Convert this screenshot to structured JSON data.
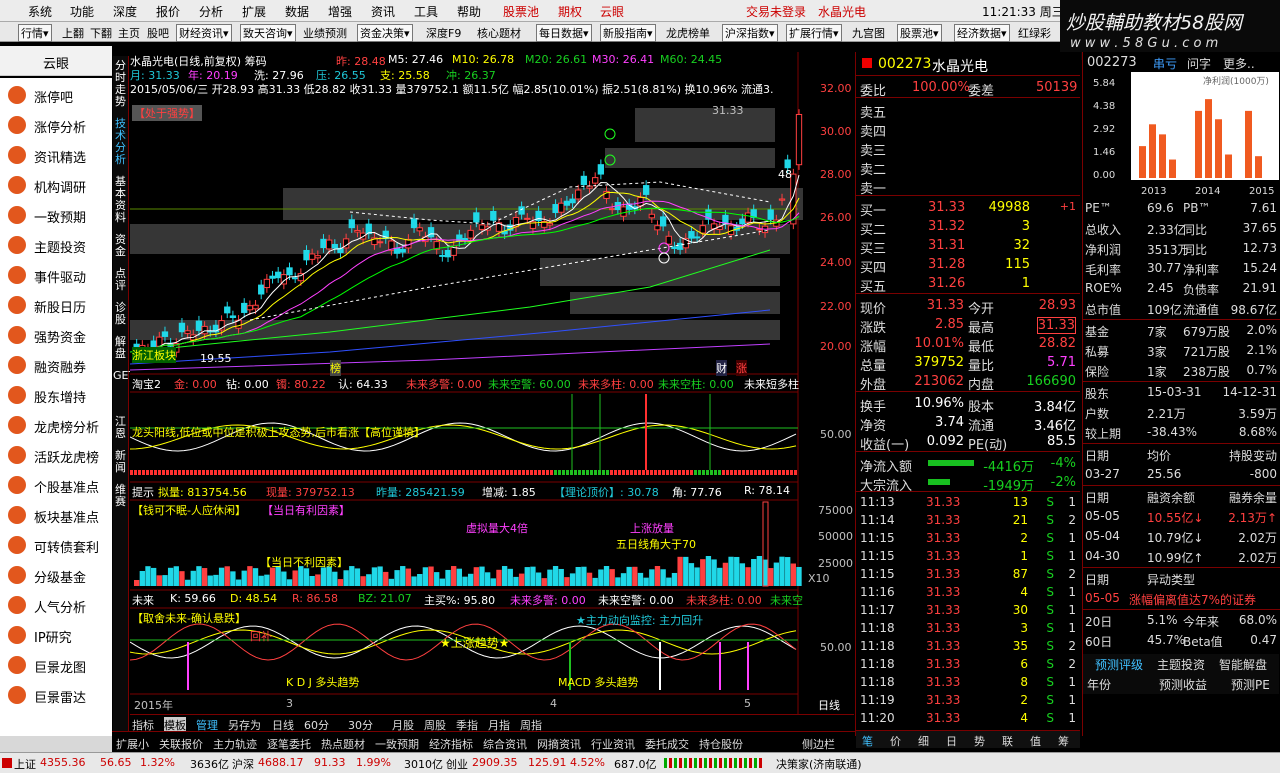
{
  "menu": {
    "items": [
      "系统",
      "功能",
      "深度",
      "报价",
      "分析",
      "扩展",
      "数据",
      "增强",
      "资讯",
      "工具",
      "帮助"
    ],
    "red_items": [
      "股票池",
      "期权",
      "云眼"
    ],
    "login": "交易未登录",
    "stock": "水晶光电",
    "clock": "11:21:33 周三"
  },
  "toolbar": {
    "items": [
      "行情▾",
      "上翻",
      "下翻",
      "主页",
      "股吧",
      "财经资讯▾",
      "致天咨询▾",
      "业绩预测",
      "资金决策▾",
      "深度F9",
      "核心题材",
      "每日数据▾",
      "新股指南▾",
      "龙虎榜单",
      "沪深指数▾",
      "扩展行情▾",
      "九宫图",
      "股票池▾",
      "经济数据▾",
      "红绿彩"
    ]
  },
  "banner": {
    "text": "炒股輔助教材58股网",
    "url": "w w w . 5 8 G u . c o m"
  },
  "sidebar": {
    "title": "云眼",
    "items": [
      "涨停吧",
      "涨停分析",
      "资讯精选",
      "机构调研",
      "一致预期",
      "主题投资",
      "事件驱动",
      "新股日历",
      "强势资金",
      "融资融券",
      "股东增持",
      "龙虎榜分析",
      "活跃龙虎榜",
      "个股基准点",
      "板块基准点",
      "可转债套利",
      "分级基金",
      "人气分析",
      "IP研究",
      "巨景龙图",
      "巨景雷达"
    ]
  },
  "vtabs": [
    "分时走势",
    "技术分析",
    "基本资料",
    "资金",
    "点评",
    "诊股",
    "解盘",
    "GET",
    "江恩",
    "新闻",
    "维赛"
  ],
  "kline": {
    "title": "水晶光电(日线,前复权)  筹码",
    "ma_line": {
      "zuo": "昨: 28.48",
      "m5": "M5: 27.46",
      "m10": "M10: 26.78",
      "m20": "M20: 26.61",
      "m30": "M30: 26.41",
      "m60": "M60: 24.45"
    },
    "line2": {
      "a": "月: 31.33",
      "b": "年: 20.19",
      "c": "洗: 27.96",
      "d": "压: 26.55",
      "e": "支: 25.58",
      "f": "冲: 26.37"
    },
    "bar_info": "2015/05/06/三 开28.93 高31.33 低28.82 收31.33 量379752.1 额11.5亿 幅2.85(10.01%) 振2.51(8.81%) 换10.96% 流通3.",
    "strong": "【处于强势】",
    "hi_label": "31.33",
    "lo_label": "19.55",
    "side_label": "48",
    "tag_bang": "榜",
    "tag_cai": "财",
    "tag_zhang": "涨",
    "tag_limit": "浙江板块",
    "yaxis": [
      "32.00",
      "30.00",
      "28.00",
      "26.00",
      "24.00",
      "22.00",
      "20.00"
    ]
  },
  "ind1": {
    "row": {
      "name": "淘宝2",
      "a": "金: 0.00",
      "b": "钻: 0.00",
      "c": "镯: 80.22",
      "d": "认: 64.33",
      "e": "未来多警: 0.00",
      "f": "未来空警: 60.00",
      "g": "未来多柱: 0.00",
      "h": "未来空柱: 0.00",
      "i": "未来短多柱"
    },
    "msg": "龙头阳线,低位或中位是积极上攻态势,后市看涨【高位谨慎】",
    "yaxis": "50.00"
  },
  "ind2": {
    "row": {
      "a": "提示",
      "b": "拟量: 813754.56",
      "c": "现量: 379752.13",
      "d": "昨量: 285421.59",
      "e": "增减: 1.85",
      "f": "【理论顶价】: 30.78",
      "g": "角: 77.76",
      "h": "R: 78.14"
    },
    "sub": "【钱可不眠-人应休闲】",
    "sub2": "【当日有利因素】",
    "m1": "虚拟量大4倍",
    "m2": "上涨放量",
    "m3": "五日线角大于70",
    "m4": "【当日不利因素】",
    "yaxis": [
      "75000",
      "50000",
      "25000"
    ],
    "x10": "X10"
  },
  "ind3": {
    "row": {
      "a": "未来",
      "b": "K: 59.66",
      "c": "D: 48.54",
      "d": "R: 86.58",
      "e": "BZ: 21.07",
      "f": "主买%: 95.80",
      "g": "未来多警: 0.00",
      "h": "未来空警: 0.00",
      "i": "未来多柱: 0.00",
      "j": "未来空"
    },
    "sub": "【取舍未来-确认悬跌】",
    "note": "★主力动向监控: 主力回升",
    "mid": "★上涨趋势★",
    "k1": "K D J 多头趋势",
    "k2": "MACD 多头趋势",
    "yaxis": "50.00",
    "tag": "回补"
  },
  "xaxis": {
    "a": "2015年",
    "b": "3",
    "c": "4",
    "d": "5",
    "e": "日线"
  },
  "btabs": [
    "指标",
    "模板",
    "管理",
    "另存为",
    "日线",
    "60分",
    "30分",
    "月股",
    "周股",
    "季指",
    "月指",
    "周指"
  ],
  "ftabs": [
    "扩展小",
    "关联报价",
    "主力轨迹",
    "逐笔委托",
    "热点题材",
    "一致预期",
    "经济指标",
    "综合资讯",
    "网摘资讯",
    "行业资讯",
    "委托成交",
    "持仓股份",
    "侧边栏"
  ],
  "quote": {
    "code": "002273",
    "name": "水晶光电",
    "wb_label": "委比",
    "wb": "100.00%",
    "wc_label": "委差",
    "wc": "50139",
    "sells": [
      "卖五",
      "卖四",
      "卖三",
      "卖二",
      "卖一"
    ],
    "buys": [
      {
        "l": "买一",
        "p": "31.33",
        "v": "49988",
        "c": "+1"
      },
      {
        "l": "买二",
        "p": "31.32",
        "v": "3",
        "c": ""
      },
      {
        "l": "买三",
        "p": "31.31",
        "v": "32",
        "c": ""
      },
      {
        "l": "买四",
        "p": "31.28",
        "v": "115",
        "c": ""
      },
      {
        "l": "买五",
        "p": "31.26",
        "v": "1",
        "c": ""
      }
    ],
    "stats": [
      {
        "a": "现价",
        "b": "31.33",
        "c": "今开",
        "d": "28.93"
      },
      {
        "a": "涨跌",
        "b": "2.85",
        "c": "最高",
        "d": "31.33"
      },
      {
        "a": "涨幅",
        "b": "10.01%",
        "c": "最低",
        "d": "28.82"
      },
      {
        "a": "总量",
        "b": "379752",
        "c": "量比",
        "d": "5.71"
      },
      {
        "a": "外盘",
        "b": "213062",
        "c": "内盘",
        "d": "166690"
      }
    ],
    "stats2": [
      {
        "a": "换手",
        "b": "10.96%",
        "c": "股本",
        "d": "3.84亿"
      },
      {
        "a": "净资",
        "b": "3.74",
        "c": "流通",
        "d": "3.46亿"
      },
      {
        "a": "收益(一)",
        "b": "0.092",
        "c": "PE(动)",
        "d": "85.5"
      }
    ],
    "flow": [
      {
        "a": "净流入额",
        "b": "-4416万",
        "c": "-4%"
      },
      {
        "a": "大宗流入",
        "b": "-1949万",
        "c": "-2%"
      }
    ],
    "ticks": [
      {
        "t": "11:13",
        "p": "31.33",
        "v": "13",
        "s": "S",
        "n": "1"
      },
      {
        "t": "11:14",
        "p": "31.33",
        "v": "21",
        "s": "S",
        "n": "2"
      },
      {
        "t": "11:15",
        "p": "31.33",
        "v": "2",
        "s": "S",
        "n": "1"
      },
      {
        "t": "11:15",
        "p": "31.33",
        "v": "1",
        "s": "S",
        "n": "1"
      },
      {
        "t": "11:15",
        "p": "31.33",
        "v": "87",
        "s": "S",
        "n": "2"
      },
      {
        "t": "11:16",
        "p": "31.33",
        "v": "4",
        "s": "S",
        "n": "1"
      },
      {
        "t": "11:17",
        "p": "31.33",
        "v": "30",
        "s": "S",
        "n": "1"
      },
      {
        "t": "11:18",
        "p": "31.33",
        "v": "3",
        "s": "S",
        "n": "1"
      },
      {
        "t": "11:18",
        "p": "31.33",
        "v": "35",
        "s": "S",
        "n": "2"
      },
      {
        "t": "11:18",
        "p": "31.33",
        "v": "6",
        "s": "S",
        "n": "2"
      },
      {
        "t": "11:18",
        "p": "31.33",
        "v": "8",
        "s": "S",
        "n": "1"
      },
      {
        "t": "11:19",
        "p": "31.33",
        "v": "2",
        "s": "S",
        "n": "1"
      },
      {
        "t": "11:20",
        "p": "31.33",
        "v": "4",
        "s": "S",
        "n": "1"
      }
    ],
    "tabs": [
      "笔",
      "价",
      "细",
      "日",
      "势",
      "联",
      "值",
      "筹"
    ]
  },
  "fin": {
    "code": "002273",
    "tabs": [
      "串亏",
      "问字",
      "更多.."
    ],
    "chart_title": "净利润(1000万)",
    "yvals": [
      "5.84",
      "4.38",
      "2.92",
      "1.46",
      "0.00"
    ],
    "years": [
      "2013",
      "2014",
      "2015"
    ],
    "rows": [
      {
        "a": "PE™",
        "b": "69.6",
        "c": "PB™",
        "d": "7.61"
      },
      {
        "a": "总收入",
        "b": "2.33亿",
        "c": "同比",
        "d": "37.65"
      },
      {
        "a": "净利润",
        "b": "3513万",
        "c": "同比",
        "d": "12.73"
      },
      {
        "a": "毛利率",
        "b": "30.77",
        "c": "净利率",
        "d": "15.24"
      },
      {
        "a": "ROE%",
        "b": "2.45",
        "c": "负债率",
        "d": "21.91"
      },
      {
        "a": "总市值",
        "b": "109亿",
        "c": "流通值",
        "d": "98.67亿"
      }
    ],
    "holders": [
      {
        "a": "基金",
        "b": "7家",
        "c": "679万股",
        "d": "2.0%"
      },
      {
        "a": "私募",
        "b": "3家",
        "c": "721万股",
        "d": "2.1%"
      },
      {
        "a": "保险",
        "b": "1家",
        "c": "238万股",
        "d": "0.7%"
      }
    ],
    "sh": [
      {
        "a": "股东",
        "b": "15-03-31",
        "c": "14-12-31"
      },
      {
        "a": "户数",
        "b": "2.21万",
        "c": "3.59万"
      },
      {
        "a": "较上期",
        "b": "-38.43%",
        "c": "8.68%"
      }
    ],
    "jc": {
      "h1": "日期",
      "h2": "均价",
      "h3": "持股变动",
      "d": "03-27",
      "p": "25.56",
      "c": "-800"
    },
    "rz": {
      "h1": "日期",
      "h2": "融资余额",
      "h3": "融券余量",
      "rows": [
        {
          "d": "05-05",
          "a": "10.55亿↓",
          "b": "2.13万↑"
        },
        {
          "d": "05-04",
          "a": "10.79亿↓",
          "b": "2.02万"
        },
        {
          "d": "04-30",
          "a": "10.99亿↑",
          "b": "2.02万"
        }
      ]
    },
    "yd": {
      "h1": "日期",
      "h2": "异动类型",
      "d": "05-05",
      "t": "涨幅偏离值达7%的证券"
    },
    "perf": [
      {
        "a": "20日",
        "b": "5.1%",
        "c": "今年来",
        "d": "68.0%"
      },
      {
        "a": "60日",
        "b": "45.7%",
        "c": "Beta值",
        "d": "0.47"
      }
    ],
    "btabs": [
      "预测评级",
      "主题投资",
      "智能解盘"
    ],
    "btabs2": [
      "年份",
      "预测收益",
      "预测PE"
    ]
  },
  "status": {
    "sh": "上证",
    "sh_v": "4355.36",
    "sh_c": "56.65",
    "sh_p": "1.32%",
    "sh_a": "3636亿",
    "sz": "沪深",
    "sz_v": "4688.17",
    "sz_c": "91.33",
    "sz_p": "1.99%",
    "sz_a": "3010亿",
    "cy": "创业",
    "cy_v": "2909.35",
    "cy_c": "125.91",
    "cy_p": "4.52%",
    "cy_a": "687.0亿",
    "firm": "决策家(济南联通)"
  }
}
